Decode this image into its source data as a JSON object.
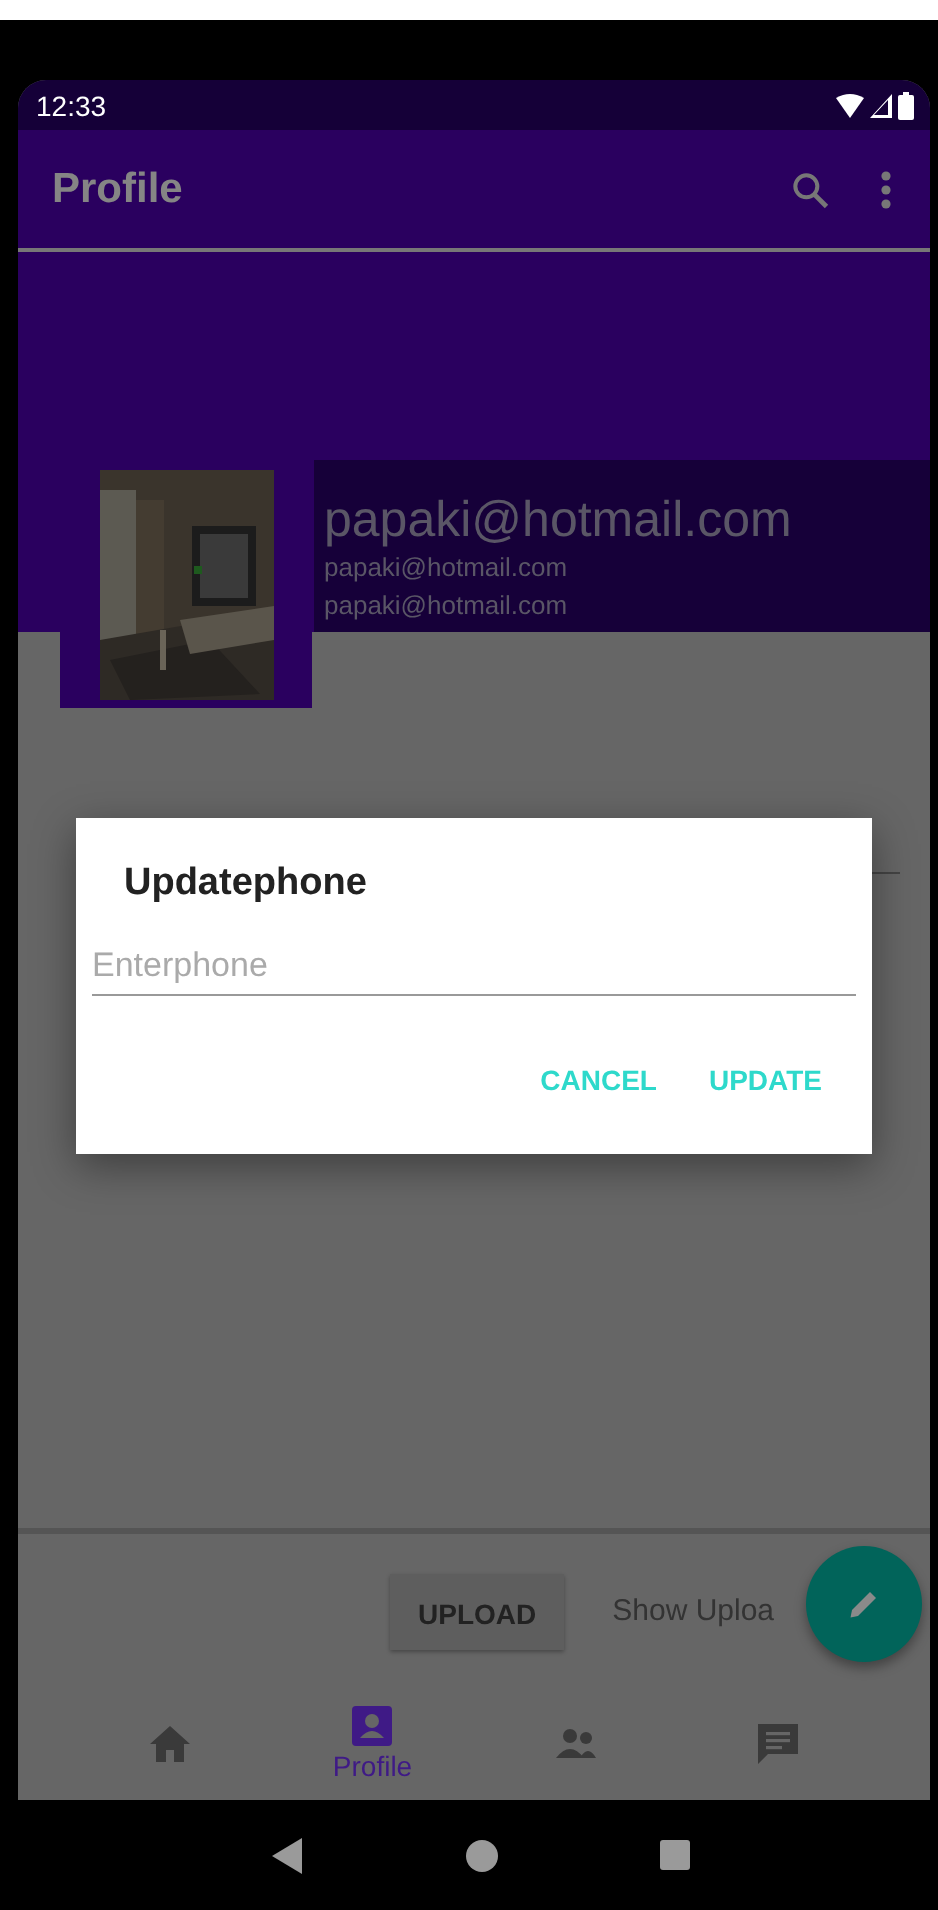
{
  "status_bar": {
    "time": "12:33"
  },
  "app_bar": {
    "title": "Profile"
  },
  "profile": {
    "display_name": "papaki@hotmail.com",
    "detail_lines": [
      "papaki@hotmail.com",
      "papaki@hotmail.com"
    ]
  },
  "upload": {
    "button": "UPLOAD",
    "label": "Show Uploa"
  },
  "bottom_nav": [
    {
      "kind": "home",
      "selected": false
    },
    {
      "kind": "profile",
      "label": "Profile",
      "selected": true
    },
    {
      "kind": "people",
      "selected": false
    },
    {
      "kind": "chat",
      "selected": false
    }
  ],
  "dialog": {
    "title": "Updatephone",
    "field": {
      "placeholder": "Enterphone"
    },
    "buttons": [
      "CANCEL",
      "UPDATE"
    ]
  }
}
